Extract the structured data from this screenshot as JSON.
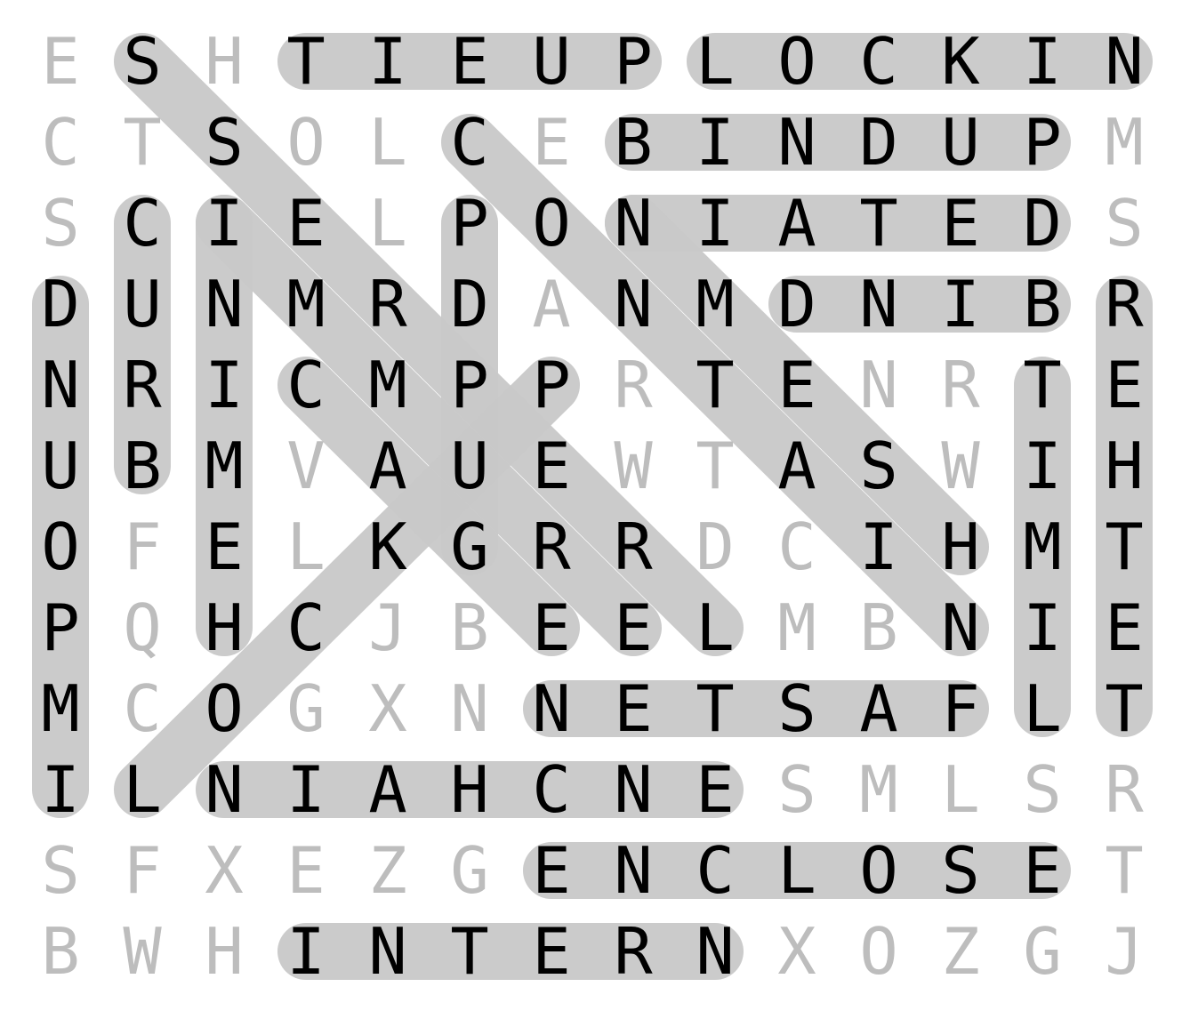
{
  "puzzle": {
    "grid": [
      "ESHTIEUPLOCKIN",
      "CTSOLCEBINDUPM",
      "SCIELPONIATEDS",
      "DUNMRDANMDNIBR",
      "NRICMPPRTENRTE",
      "UBMVAUEWTASWIH",
      "OFELKGRRDCIHMT",
      "PQHCJBEELMBNIE",
      "MCOGXNNETSAFLT",
      "ILNIAHCNESMLSR",
      "SFXEZGENCLOSET",
      "BWHINTERNXOZGJ"
    ],
    "found_paths": [
      {
        "r1": 0,
        "c1": 1,
        "r2": 7,
        "c2": 8
      },
      {
        "r1": 0,
        "c1": 3,
        "r2": 0,
        "c2": 7
      },
      {
        "r1": 0,
        "c1": 8,
        "r2": 0,
        "c2": 13
      },
      {
        "r1": 1,
        "c1": 5,
        "r2": 7,
        "c2": 11
      },
      {
        "r1": 1,
        "c1": 7,
        "r2": 1,
        "c2": 12
      },
      {
        "r1": 2,
        "c1": 1,
        "r2": 5,
        "c2": 1
      },
      {
        "r1": 2,
        "c1": 2,
        "r2": 7,
        "c2": 7
      },
      {
        "r1": 2,
        "c1": 2,
        "r2": 7,
        "c2": 2
      },
      {
        "r1": 2,
        "c1": 5,
        "r2": 6,
        "c2": 5
      },
      {
        "r1": 2,
        "c1": 7,
        "r2": 2,
        "c2": 12
      },
      {
        "r1": 2,
        "c1": 7,
        "r2": 6,
        "c2": 11
      },
      {
        "r1": 3,
        "c1": 0,
        "r2": 9,
        "c2": 0
      },
      {
        "r1": 3,
        "c1": 9,
        "r2": 3,
        "c2": 12
      },
      {
        "r1": 3,
        "c1": 13,
        "r2": 8,
        "c2": 13
      },
      {
        "r1": 4,
        "c1": 3,
        "r2": 7,
        "c2": 6
      },
      {
        "r1": 4,
        "c1": 6,
        "r2": 9,
        "c2": 1
      },
      {
        "r1": 4,
        "c1": 12,
        "r2": 8,
        "c2": 12
      },
      {
        "r1": 8,
        "c1": 6,
        "r2": 8,
        "c2": 11
      },
      {
        "r1": 9,
        "c1": 2,
        "r2": 9,
        "c2": 8
      },
      {
        "r1": 10,
        "c1": 6,
        "r2": 10,
        "c2": 12
      },
      {
        "r1": 11,
        "c1": 3,
        "r2": 11,
        "c2": 8
      }
    ],
    "colors": {
      "found_letter": "#000000",
      "unfound_letter": "#bdbdbd",
      "highlight": "#c8c8c8",
      "background": "#ffffff"
    }
  }
}
